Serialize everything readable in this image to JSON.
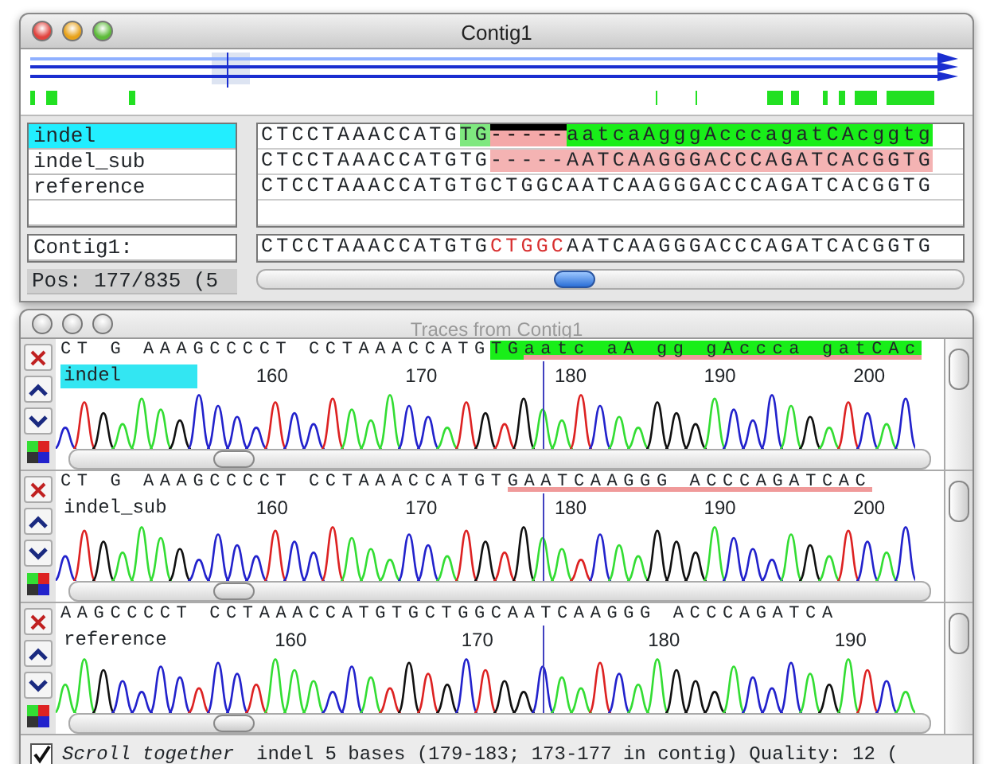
{
  "contig_window": {
    "title": "Contig1",
    "active": true
  },
  "sequences": [
    {
      "name": "indel",
      "selected": true,
      "segments": [
        {
          "text": "CTCCTAAACCATG",
          "kind": "plain"
        },
        {
          "text": "TG",
          "kind": "light-match"
        },
        {
          "text": "-----",
          "kind": "gap-mark"
        },
        {
          "text": "aatcaAgggAcccagatCAcggtg",
          "kind": "match"
        }
      ]
    },
    {
      "name": "indel_sub",
      "selected": false,
      "segments": [
        {
          "text": "CTCCTAAACCATGTG",
          "kind": "plain"
        },
        {
          "text": "-----AATCAAGGGACCCAGATCACGGTG",
          "kind": "mismatch"
        }
      ]
    },
    {
      "name": "reference",
      "selected": false,
      "segments": [
        {
          "text": "CTCCTAAACCATGTGCTGGCAATCAAGGGACCCAGATCACGGTG",
          "kind": "plain"
        }
      ]
    }
  ],
  "consensus": {
    "label": "Contig1:",
    "position": "Pos: 177/835 (5",
    "segments": [
      {
        "text": "CTCCTAAACCATGTG",
        "kind": "plain"
      },
      {
        "text": "CTGGC",
        "kind": "changed"
      },
      {
        "text": "AATCAAGGGACCCAGATCACGGTG",
        "kind": "plain"
      }
    ]
  },
  "traces_window": {
    "title": "Traces from Contig1",
    "active": false
  },
  "traces": [
    {
      "name": "indel",
      "selected": true,
      "bases": [
        {
          "text": "CT G AAAGCCCCT CCTAAACCATG",
          "kind": "plain"
        },
        {
          "text": "TG",
          "kind": "match"
        },
        {
          "text": "aatc aA gg gAccca gatCAc",
          "kind": "match-mismatch"
        }
      ],
      "ticks": [
        "160",
        "170",
        "180",
        "190",
        "200"
      ]
    },
    {
      "name": "indel_sub",
      "selected": false,
      "bases": [
        {
          "text": "CT G AAAGCCCCT CCTAAACCATGT",
          "kind": "plain"
        },
        {
          "text": "GAATCAAGGG ACCCAGATCAC",
          "kind": "mismatch"
        }
      ],
      "ticks": [
        "160",
        "170",
        "180",
        "190",
        "200"
      ]
    },
    {
      "name": "reference",
      "selected": false,
      "bases": [
        {
          "text": "AAGCCCCT CCTAAACCATGTGCTGGCAATCAAGGG ACCCAGATCA",
          "kind": "plain"
        }
      ],
      "ticks": [
        "160",
        "170",
        "180",
        "190"
      ]
    }
  ],
  "status_bar": {
    "scroll_together": {
      "label": "Scroll together",
      "checked": true
    },
    "message": "indel 5 bases (179-183; 173-177 in contig) Quality: 12 ("
  }
}
